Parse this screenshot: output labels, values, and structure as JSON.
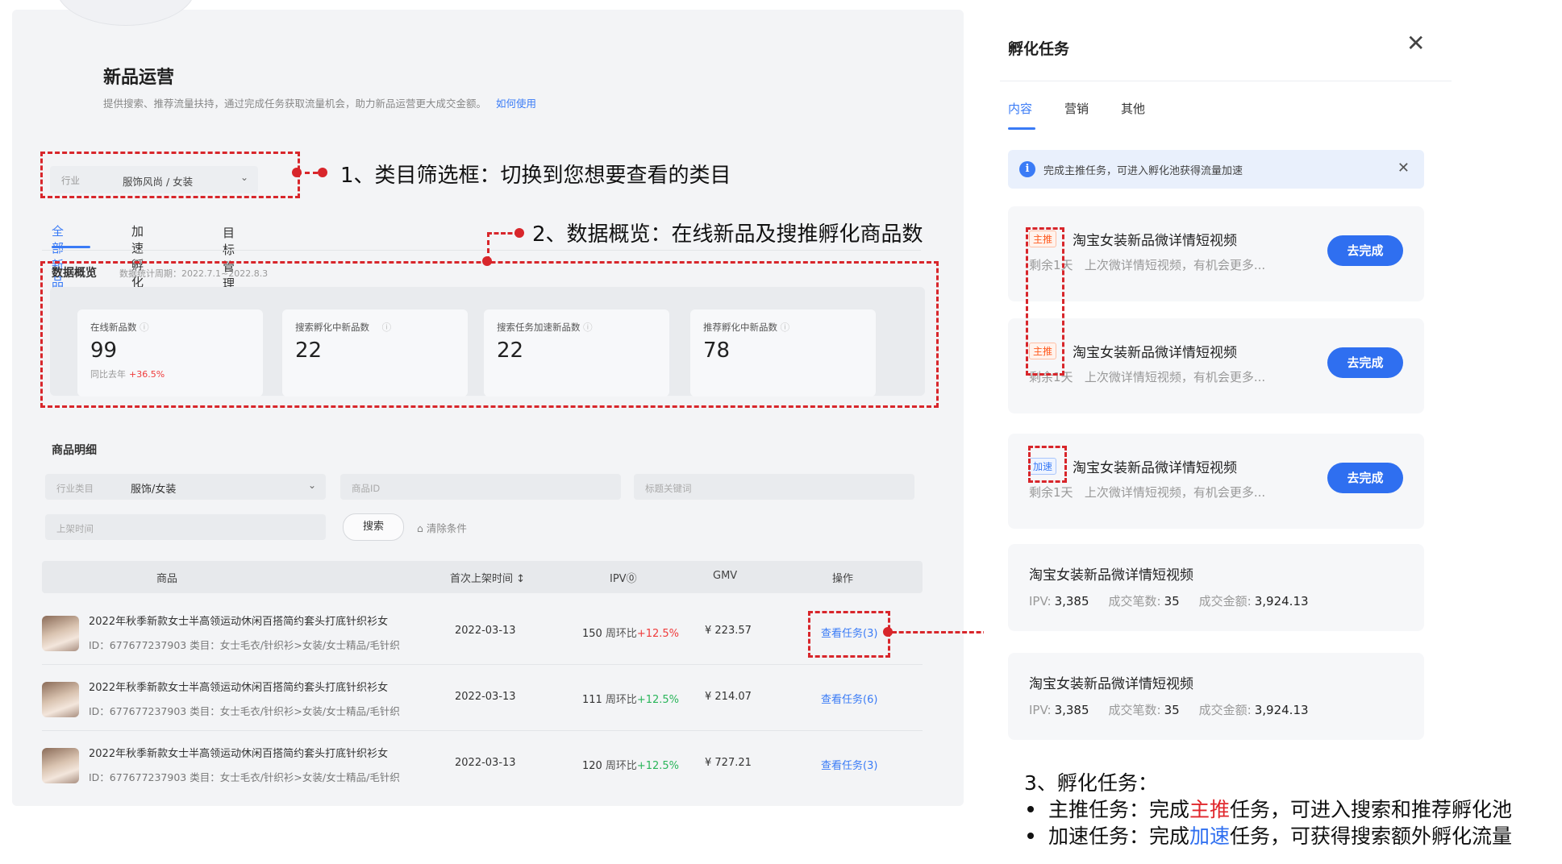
{
  "header": {
    "title": "新品运营",
    "description": "提供搜索、推荐流量扶持，通过完成任务获取流量机会，助力新品运营更大成交金额。",
    "help_link": "如何使用"
  },
  "category_filter": {
    "label": "行业",
    "value": "服饰风尚 / 女装"
  },
  "tabs": [
    "全部新品",
    "加速孵化",
    "目标管理"
  ],
  "overview": {
    "title": "数据概览",
    "period": "数据统计周期：2022.7.1~2022.8.3",
    "metrics": [
      {
        "label": "在线新品数",
        "value": "99",
        "sub": "同比去年",
        "delta": "+36.5%"
      },
      {
        "label": "搜索孵化中新品数",
        "value": "22"
      },
      {
        "label": "搜索任务加速新品数",
        "value": "22"
      },
      {
        "label": "推荐孵化中新品数",
        "value": "78"
      }
    ]
  },
  "detail": {
    "title": "商品明细",
    "filters": {
      "industry_label": "行业类目",
      "industry_value": "服饰/女装",
      "product_id_placeholder": "商品ID",
      "keyword_placeholder": "标题关键词",
      "listing_time_placeholder": "上架时间",
      "search_button": "搜索",
      "clear_button": "清除条件"
    },
    "columns": [
      "商品",
      "首次上架时间 ↕",
      "IPV⓪",
      "GMV",
      "操作"
    ],
    "rows": [
      {
        "name": "2022年秋季新款女士半高领运动休闲百搭简约套头打底针织衫女",
        "meta": "ID：677677237903    类目：女士毛衣/针织衫>女装/女士精品/毛针织",
        "date": "2022-03-13",
        "ipv": "150",
        "ipv_label": "周环比",
        "ipv_delta": "+12.5%",
        "gmv": "¥ 223.57",
        "action": "查看任务(3)"
      },
      {
        "name": "2022年秋季新款女士半高领运动休闲百搭简约套头打底针织衫女",
        "meta": "ID：677677237903    类目：女士毛衣/针织衫>女装/女士精品/毛针织",
        "date": "2022-03-13",
        "ipv": "111",
        "ipv_label": "周环比",
        "ipv_delta": "+12.5%",
        "gmv": "¥ 214.07",
        "action": "查看任务(6)"
      },
      {
        "name": "2022年秋季新款女士半高领运动休闲百搭简约套头打底针织衫女",
        "meta": "ID：677677237903    类目：女士毛衣/针织衫>女装/女士精品/毛针织",
        "date": "2022-03-13",
        "ipv": "120",
        "ipv_label": "周环比",
        "ipv_delta": "+12.5%",
        "gmv": "¥ 727.21",
        "action": "查看任务(3)"
      }
    ]
  },
  "annotations": {
    "a1": "1、类目筛选框：切换到您想要查看的类目",
    "a2": "2、数据概览：在线新品及搜推孵化商品数",
    "a3_title": "3、孵化任务：",
    "a3_line1_pre": "主推任务：完成",
    "a3_line1_hl": "主推",
    "a3_line1_post": "任务，可进入搜索和推荐孵化池",
    "a3_line2_pre": "加速任务：完成",
    "a3_line2_hl": "加速",
    "a3_line2_post": "任务，可获得搜索额外孵化流量",
    "colors": {
      "annotation": "#d8262b",
      "main_highlight": "#e0262b",
      "speed_highlight": "#2f6ff0"
    }
  },
  "drawer": {
    "title": "孵化任务",
    "tabs": [
      "内容",
      "营销",
      "其他"
    ],
    "notice": "完成主推任务，可进入孵化池获得流量加速",
    "tasks": [
      {
        "badge": "主推",
        "title": "淘宝女装新品微详情短视频",
        "remaining": "剩余1天",
        "desc": "上次微详情短视频，有机会更多...",
        "button": "去完成"
      },
      {
        "badge": "主推",
        "title": "淘宝女装新品微详情短视频",
        "remaining": "剩余1天",
        "desc": "上次微详情短视频，有机会更多...",
        "button": "去完成"
      },
      {
        "badge": "加速",
        "title": "淘宝女装新品微详情短视频",
        "remaining": "剩余1天",
        "desc": "上次微详情短视频，有机会更多...",
        "button": "去完成"
      }
    ],
    "completed": [
      {
        "title": "淘宝女装新品微详情短视频",
        "ipv_label": "IPV:",
        "ipv": "3,385",
        "orders_label": "成交笔数:",
        "orders": "35",
        "amount_label": "成交金额:",
        "amount": "3,924.13"
      },
      {
        "title": "淘宝女装新品微详情短视频",
        "ipv_label": "IPV:",
        "ipv": "3,385",
        "orders_label": "成交笔数:",
        "orders": "35",
        "amount_label": "成交金额:",
        "amount": "3,924.13"
      }
    ]
  }
}
